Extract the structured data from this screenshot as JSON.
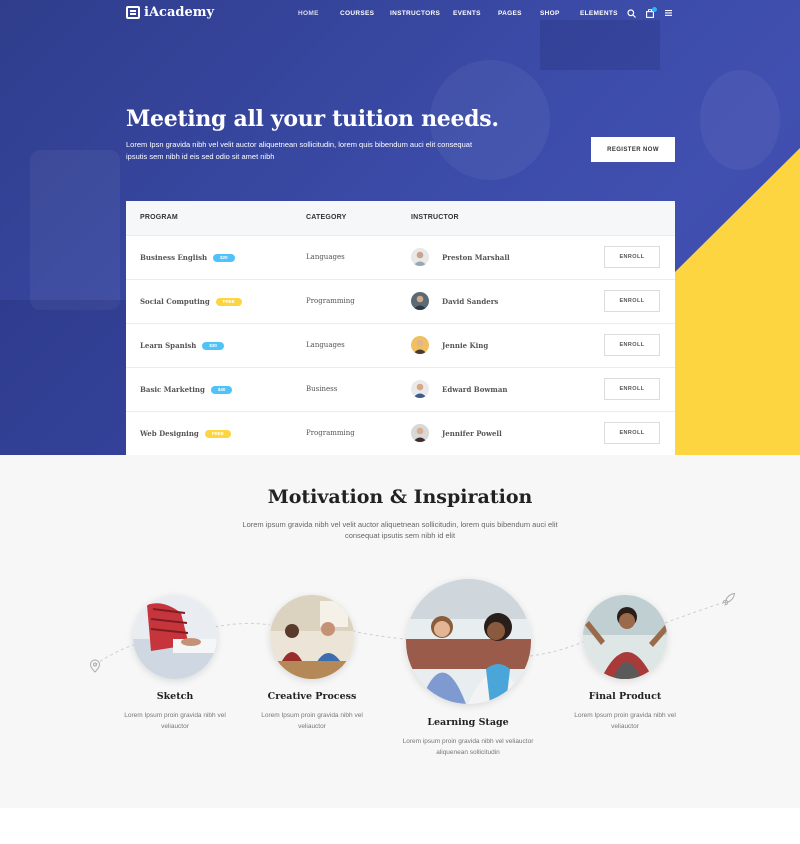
{
  "nav": {
    "logo": "iAcademy",
    "items": [
      "HOME",
      "COURSES",
      "INSTRUCTORS",
      "EVENTS",
      "PAGES",
      "SHOP",
      "ELEMENTS"
    ],
    "icons": [
      "search-icon",
      "cart-icon",
      "menu-icon"
    ]
  },
  "hero": {
    "title": "Meeting all your tuition needs.",
    "subtitle": "Lorem Ipsn gravida nibh vel velit auctor aliquetnean sollicitudin, lorem quis bibendum auci elit consequat ipsutis sem nibh id eis sed odio sit amet nibh",
    "button": "REGISTER NOW",
    "colors": {
      "primary": "#3a4aa6",
      "accent": "#fdd540"
    }
  },
  "table": {
    "headers": [
      "PROGRAM",
      "CATEGORY",
      "INSTRUCTOR"
    ],
    "rows": [
      {
        "program": "Business English",
        "badge": "$20",
        "badge_color": "#4fc3f7",
        "category": "Languages",
        "instructor": "Preston Marshall",
        "action": "ENROLL"
      },
      {
        "program": "Social Computing",
        "badge": "FREE",
        "badge_color": "#fdd540",
        "category": "Programming",
        "instructor": "David Sanders",
        "action": "ENROLL"
      },
      {
        "program": "Learn Spanish",
        "badge": "$30",
        "badge_color": "#4fc3f7",
        "category": "Languages",
        "instructor": "Jennie King",
        "action": "ENROLL"
      },
      {
        "program": "Basic Marketing",
        "badge": "$40",
        "badge_color": "#4fc3f7",
        "category": "Business",
        "instructor": "Edward Bowman",
        "action": "ENROLL"
      },
      {
        "program": "Web Designing",
        "badge": "FREE",
        "badge_color": "#fdd540",
        "category": "Programming",
        "instructor": "Jennifer Powell",
        "action": "ENROLL"
      }
    ]
  },
  "motivation": {
    "title": "Motivation & Inspiration",
    "subtitle": "Lorem ipsum gravida nibh vel velit auctor aliquetnean sollicitudin, lorem quis bibendum auci elit consequat ipsutis sem nibh id elit",
    "steps": [
      {
        "title": "Sketch",
        "desc": "Lorem Ipsum proin gravida nibh vel veliauctor"
      },
      {
        "title": "Creative Process",
        "desc": "Lorem Ipsum proin gravida nibh vel veliauctor"
      },
      {
        "title": "Learning Stage",
        "desc": "Lorem ipsum proin gravida nibh vel veliauctor aliquenean sollicitudin"
      },
      {
        "title": "Final Product",
        "desc": "Lorem Ipsum proin gravida nibh vel veliauctor"
      }
    ]
  }
}
